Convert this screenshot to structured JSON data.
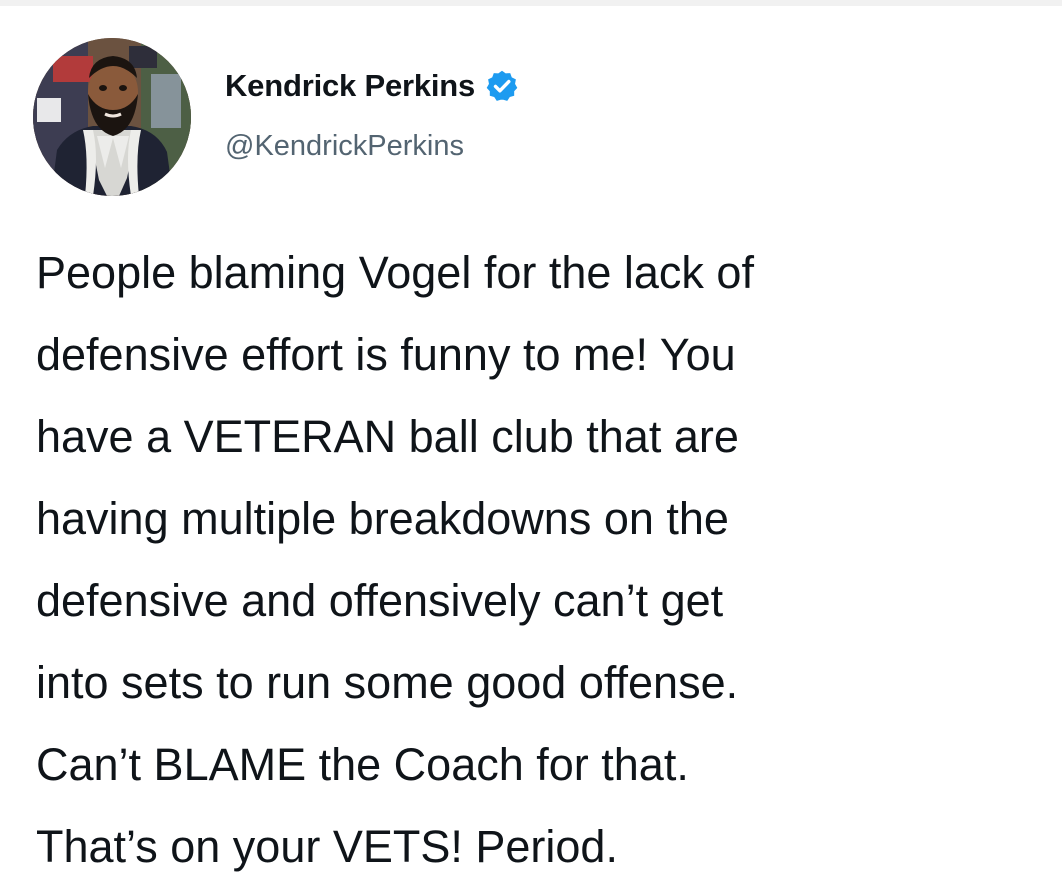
{
  "user": {
    "display_name": "Kendrick Perkins",
    "handle": "@KendrickPerkins",
    "verified": true,
    "avatar_icon": "profile-photo",
    "verified_icon": "verified-badge-icon"
  },
  "tweet": {
    "lines": [
      "People blaming Vogel for the lack of",
      "defensive effort is funny to me! You",
      "have a VETERAN ball club that are",
      "having multiple breakdowns on the",
      "defensive and offensively can’t get",
      "into sets to run some good offense.",
      "Can’t BLAME the Coach for that.",
      "That’s on your VETS! Period."
    ]
  },
  "colors": {
    "text": "#0f1419",
    "secondary_text": "#536471",
    "verified_blue": "#1d9bf0"
  }
}
